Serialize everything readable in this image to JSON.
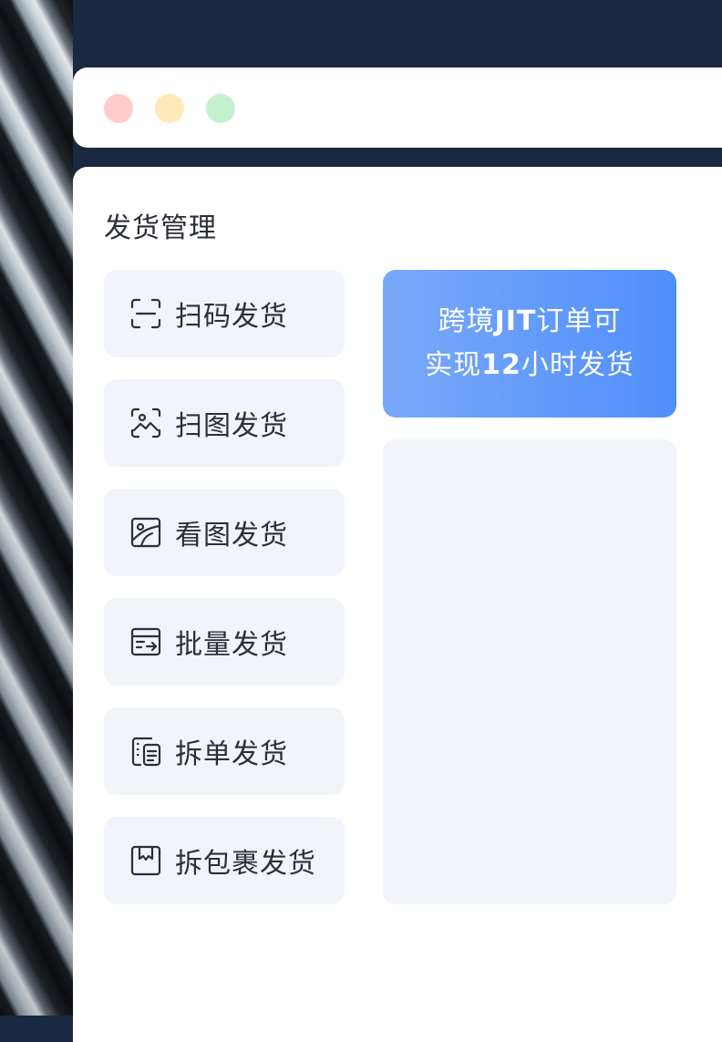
{
  "window": {
    "controls": [
      "close",
      "minimize",
      "maximize"
    ]
  },
  "section": {
    "title": "发货管理"
  },
  "menu": [
    {
      "label": "扫码发货",
      "icon": "scan-code-icon"
    },
    {
      "label": "扫图发货",
      "icon": "scan-image-icon"
    },
    {
      "label": "看图发货",
      "icon": "view-image-icon"
    },
    {
      "label": "批量发货",
      "icon": "batch-ship-icon"
    },
    {
      "label": "拆单发货",
      "icon": "split-order-icon"
    },
    {
      "label": "拆包裹发货",
      "icon": "split-package-icon"
    }
  ],
  "promo": {
    "line1_pre": "跨境",
    "line1_bold": "JIT",
    "line1_post": "订单可",
    "line2_pre": "实现",
    "line2_bold": "12",
    "line2_post": "小时发货"
  },
  "colors": {
    "navy": "#1a2942",
    "accent": "#4f8ffa",
    "card": "#f1f4f9",
    "dot_red": "#ffcccb",
    "dot_yellow": "#ffe9b8",
    "dot_green": "#c4efcd"
  }
}
